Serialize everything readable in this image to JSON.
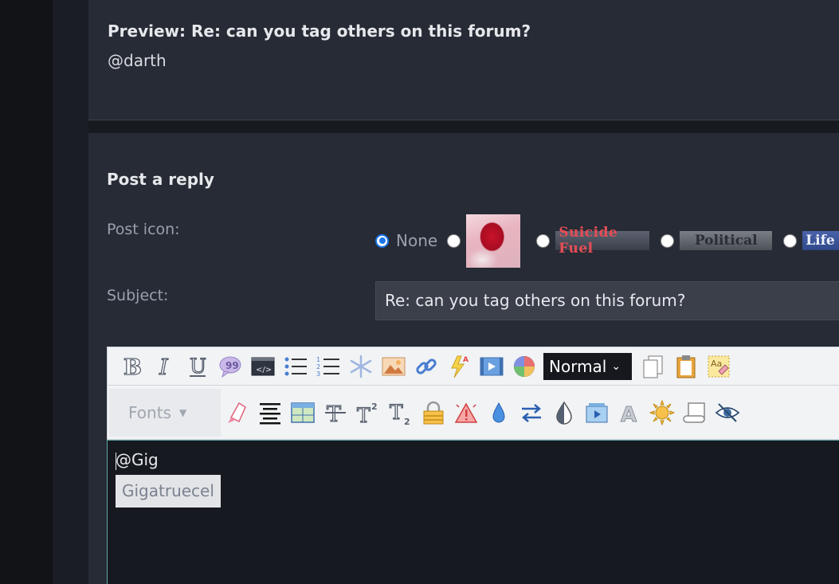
{
  "preview": {
    "title": "Preview: Re: can you tag others on this forum?",
    "body": "@darth"
  },
  "reply": {
    "title": "Post a reply",
    "post_icon_label": "Post icon:",
    "subject_label": "Subject:",
    "subject_value": "Re: can you tag others on this forum?",
    "icons": {
      "none_label": "None",
      "suicide_fuel": "Suicide Fuel",
      "political": "Political",
      "life": "Life"
    },
    "format_select": "Normal",
    "fonts_label": "Fonts",
    "editor_text": "@Gig",
    "suggestion": "Gigatruecel"
  },
  "colors": {
    "background": "#1e2128",
    "panel": "#262b35",
    "radio_accent": "#1a73e8",
    "editor_border": "#5fa8a8"
  }
}
